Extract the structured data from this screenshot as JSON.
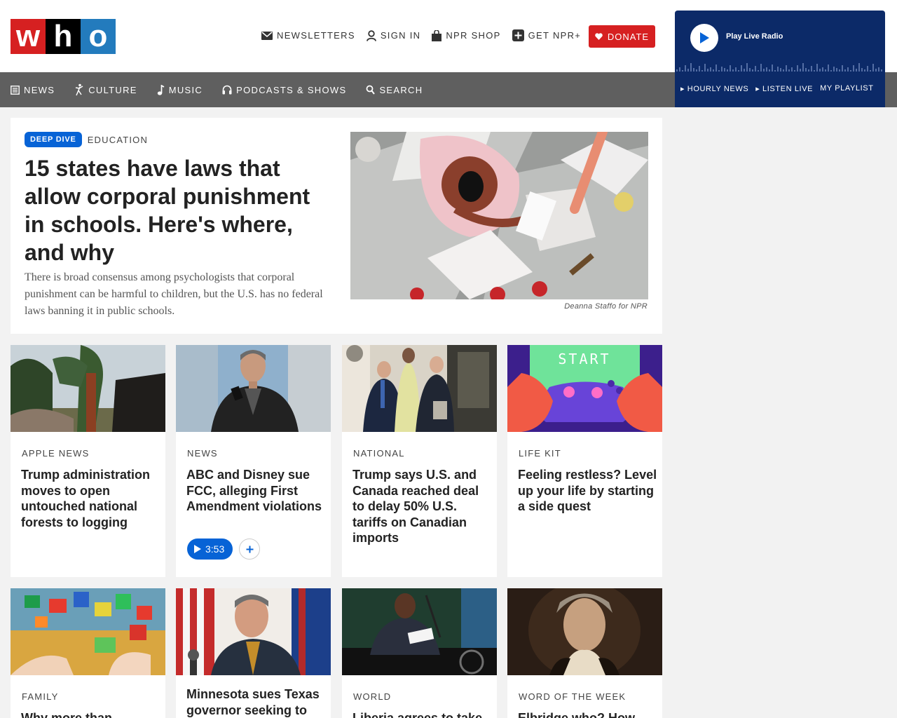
{
  "brand": {
    "logo_letters": [
      "w",
      "h",
      "o"
    ]
  },
  "utility_nav": [
    {
      "label": "NEWSLETTERS",
      "icon": "mail-icon"
    },
    {
      "label": "SIGN IN",
      "icon": "user-icon"
    },
    {
      "label": "NPR SHOP",
      "icon": "bag-icon"
    },
    {
      "label": "GET NPR+",
      "icon": "plus-square-icon"
    }
  ],
  "donate": {
    "label": "DONATE",
    "icon": "heart-icon",
    "color": "#d62021"
  },
  "player": {
    "label": "Play Live Radio",
    "links": [
      "HOURLY NEWS",
      "LISTEN LIVE",
      "MY PLAYLIST"
    ],
    "color": "#0c2a68"
  },
  "main_nav": [
    {
      "label": "NEWS",
      "icon": "newspaper-icon"
    },
    {
      "label": "CULTURE",
      "icon": "dancer-icon"
    },
    {
      "label": "MUSIC",
      "icon": "music-note-icon"
    },
    {
      "label": "PODCASTS & SHOWS",
      "icon": "headphones-icon"
    },
    {
      "label": "SEARCH",
      "icon": "search-icon"
    }
  ],
  "lead": {
    "badge": "DEEP DIVE",
    "section": "EDUCATION",
    "title": "15 states have laws that allow corporal punishment in schools. Here's where, and why",
    "teaser": "There is broad consensus among psychologists that corporal punishment can be harmful to children, but the U.S. has no federal laws banning it in public schools.",
    "credit": "Deanna Staffo for NPR"
  },
  "cards": [
    {
      "slug": "APPLE NEWS",
      "headline": "Trump administration moves to open untouched national forests to logging"
    },
    {
      "slug": "NEWS",
      "headline": "ABC and Disney sue FCC, alleging First Amendment violations",
      "audio_duration": "3:53"
    },
    {
      "slug": "NATIONAL",
      "headline": "Trump says U.S. and Canada reached deal to delay 50% U.S. tariffs on Canadian imports"
    },
    {
      "slug": "LIFE KIT",
      "headline": "Feeling restless? Level up your life by starting a side quest"
    },
    {
      "slug": "FAMILY",
      "headline": "Why more than"
    },
    {
      "slug": "",
      "headline": "Minnesota sues Texas governor seeking to"
    },
    {
      "slug": "WORLD",
      "headline": "Liberia agrees to take"
    },
    {
      "slug": "WORD OF THE WEEK",
      "headline": "Elbridge who? How"
    }
  ],
  "game_thumb_text": "START"
}
